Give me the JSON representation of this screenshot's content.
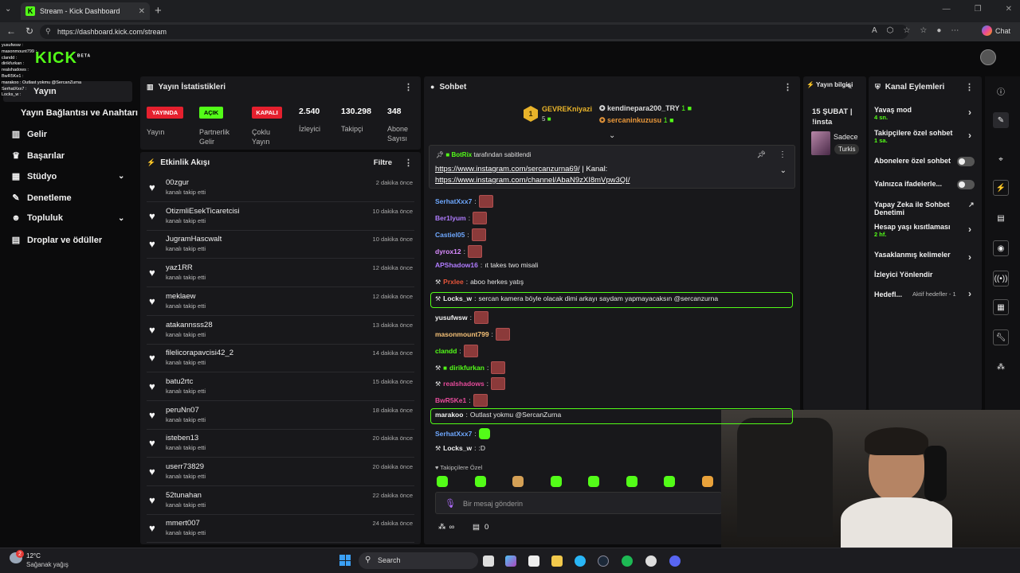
{
  "browser": {
    "tab_title": "Stream - Kick Dashboard",
    "url": "https://dashboard.kick.com/stream",
    "chat_label": "Chat"
  },
  "logo": {
    "text": "KICK",
    "beta": "BETA"
  },
  "overlay_log": [
    "yusufwsw :",
    "masonmount799 :",
    "clandd :",
    "dirikfurkan :",
    "realshadows :",
    "BwR5Ke1 :",
    "marakoo : Outlast yokmu @SercanZurna",
    "SerhatXxx7 :",
    "Locks_w :"
  ],
  "sidebar": {
    "top": "Yayın",
    "items": [
      {
        "label": "Yayın Bağlantısı ve Anahtarı",
        "icon": ""
      },
      {
        "label": "Gelir",
        "icon": "chart-icon"
      },
      {
        "label": "Başarılar",
        "icon": "trophy-icon"
      },
      {
        "label": "Stüdyo",
        "icon": "studio-icon",
        "chev": true
      },
      {
        "label": "Denetleme",
        "icon": "wrench-icon"
      },
      {
        "label": "Topluluk",
        "icon": "people-icon",
        "chev": true
      },
      {
        "label": "Droplar ve ödüller",
        "icon": "gift-icon"
      }
    ]
  },
  "stats": {
    "title": "Yayın İstatistikleri",
    "badges": [
      {
        "text": "YAYINDA",
        "label": "Yayın",
        "color": "#e5202e"
      },
      {
        "text": "AÇIK",
        "label": "Partnerlik Gelir",
        "color": "#53fc18"
      },
      {
        "text": "KAPALI",
        "label": "Çoklu Yayın",
        "color": "#e5202e"
      }
    ],
    "numbers": [
      {
        "value": "2.540",
        "label": "İzleyici"
      },
      {
        "value": "130.298",
        "label": "Takipçi"
      },
      {
        "value": "348",
        "label": "Abone Sayısı"
      }
    ]
  },
  "activity": {
    "title": "Etkinlik Akışı",
    "filter": "Filtre",
    "subtext": "kanalı takip etti",
    "rows": [
      {
        "name": "00zgur",
        "time": "2 dakika önce"
      },
      {
        "name": "OtizmliEsekTicaretcisi",
        "time": "10 dakika önce"
      },
      {
        "name": "JugramHascwalt",
        "time": "10 dakika önce"
      },
      {
        "name": "yaz1RR",
        "time": "12 dakika önce"
      },
      {
        "name": "meklaew",
        "time": "12 dakika önce"
      },
      {
        "name": "atakannsss28",
        "time": "13 dakika önce"
      },
      {
        "name": "filelicorapavcisi42_2",
        "time": "14 dakika önce"
      },
      {
        "name": "batu2rtc",
        "time": "15 dakika önce"
      },
      {
        "name": "peruNn07",
        "time": "18 dakika önce"
      },
      {
        "name": "isteben13",
        "time": "20 dakika önce"
      },
      {
        "name": "userr73829",
        "time": "20 dakika önce"
      },
      {
        "name": "52tunahan",
        "time": "22 dakika önce"
      },
      {
        "name": "mmert007",
        "time": "24 dakika önce"
      }
    ]
  },
  "chat": {
    "title": "Sohbet",
    "top_gifter": {
      "name": "GEVREKniyazi",
      "count": "5",
      "rank": "1"
    },
    "gifters": [
      {
        "name": "kendinepara200_TRY",
        "count": "1"
      },
      {
        "name": "sercaninkuzusu",
        "count": "1"
      }
    ],
    "pinned": {
      "by": "BotRix",
      "label": "tarafından sabitlendi",
      "line1": "https://www.instagram.com/sercanzurna69/",
      "sep": "| Kanal:",
      "line2": "https://www.instagram.com/channel/AbaN9zXI8mVpw3QI/"
    },
    "messages": [
      {
        "user": "SerhatXxx7",
        "color": "#6ea8ff",
        "text": "",
        "emote": true
      },
      {
        "user": "Ber1lyum",
        "color": "#b07cff",
        "text": "",
        "emote": true
      },
      {
        "user": "Castiel05",
        "color": "#6ea8ff",
        "text": "",
        "emote": true
      },
      {
        "user": "dyrox12",
        "color": "#d98bff",
        "text": "",
        "emote": true
      },
      {
        "user": "APShadow16",
        "color": "#b07cff",
        "text": "ıt takes two misali",
        "emote": false
      },
      {
        "user": "Prxlee",
        "color": "#e8553a",
        "text": "aboo herkes yatış",
        "emote": false
      },
      {
        "user": "Locks_w",
        "color": "#f0f0f0",
        "text": "sercan kamera böyle olacak dimi arkayı saydam yapmayacaksın @sercanzurna",
        "emote": false
      },
      {
        "user": "yusufwsw",
        "color": "#f0f0f0",
        "text": "",
        "emote": true
      },
      {
        "user": "masonmount799",
        "color": "#f6c177",
        "text": "",
        "emote": true
      },
      {
        "user": "clandd",
        "color": "#53fc18",
        "text": "",
        "emote": true
      },
      {
        "user": "dirikfurkan",
        "color": "#53fc18",
        "text": "",
        "emote": true
      },
      {
        "user": "realshadows",
        "color": "#e54b9a",
        "text": "",
        "emote": true
      },
      {
        "user": "BwR5Ke1",
        "color": "#e54b9a",
        "text": "",
        "emote": true
      },
      {
        "user": "marakoo",
        "color": "#f0f0f0",
        "text": "Outlast yokmu @SercanZurna",
        "emote": false
      },
      {
        "user": "SerhatXxx7",
        "color": "#6ea8ff",
        "text": "",
        "emote": true
      },
      {
        "user": "Locks_w",
        "color": "#f0f0f0",
        "text": ":D",
        "emote": false
      }
    ],
    "followers_only": "Takipçilere Özel",
    "input_placeholder": "Bir mesaj gönderin",
    "infinity": "∞",
    "points": "0"
  },
  "stream_info": {
    "title": "Yayın bilgisi",
    "date": "15 ŞUBAT | !insta",
    "cat_text": "Sadece",
    "cat_tag": "Turkis"
  },
  "channel_actions": {
    "title": "Kanal Eylemleri",
    "items": [
      {
        "label": "Yavaş mod",
        "sub": "4 sn.",
        "type": "chev"
      },
      {
        "label": "Takipçilere özel sohbet",
        "sub": "1 sa.",
        "type": "chev"
      },
      {
        "label": "Abonelere özel sohbet",
        "sub": "",
        "type": "toggle"
      },
      {
        "label": "Yalnızca ifadelerle...",
        "sub": "",
        "type": "toggle"
      },
      {
        "label": "Yapay Zeka ile Sohbet Denetimi",
        "sub": "",
        "type": "ext"
      },
      {
        "label": "Hesap yaşı kısıtlaması",
        "sub": "2 hf.",
        "type": "chev"
      },
      {
        "label": "Yasaklanmış kelimeler",
        "sub": "",
        "type": "chev"
      },
      {
        "label": "İzleyici Yönlendir",
        "sub": "",
        "type": "none"
      },
      {
        "label": "Hedefl...",
        "sub": "Aktif hedefler - 1",
        "type": "chev"
      }
    ]
  },
  "taskbar": {
    "weather_temp": "12°C",
    "weather_desc": "Sağanak yağış",
    "search": "Search",
    "badge": "2"
  }
}
